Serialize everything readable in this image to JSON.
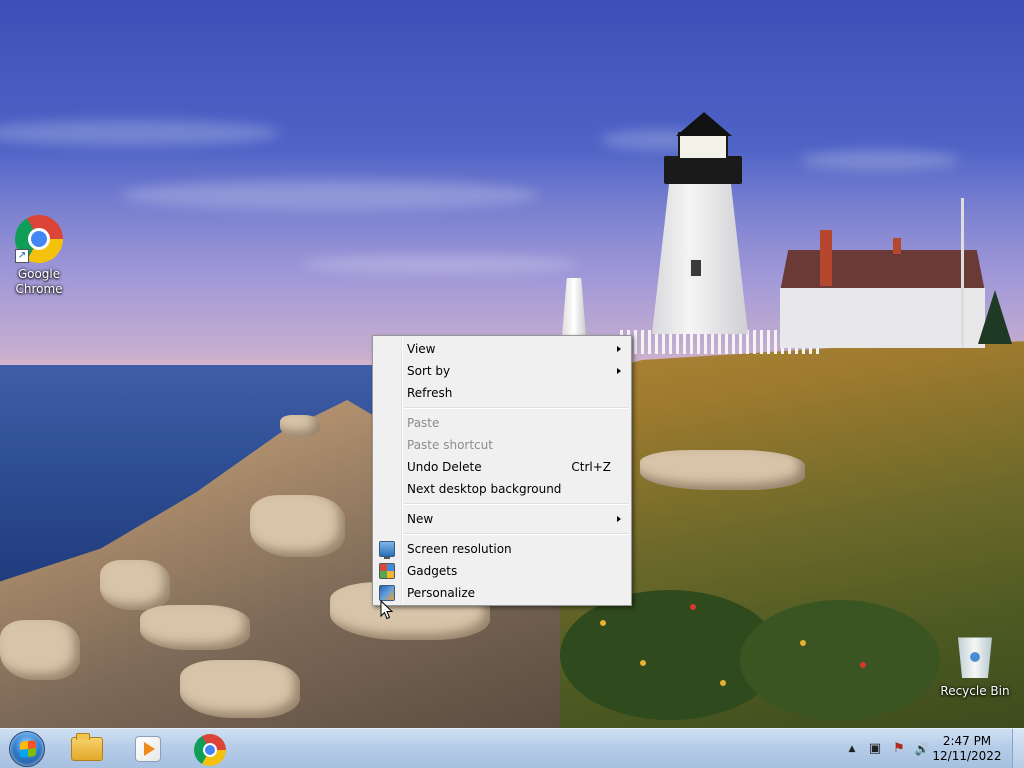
{
  "desktop": {
    "icons": [
      {
        "label": "Google\nChrome",
        "icon": "chrome-icon"
      },
      {
        "label": "Recycle Bin",
        "icon": "recycle-bin-icon"
      }
    ]
  },
  "context_menu": {
    "items": [
      {
        "label": "View",
        "submenu": true
      },
      {
        "label": "Sort by",
        "submenu": true
      },
      {
        "label": "Refresh"
      },
      {
        "separator": true
      },
      {
        "label": "Paste",
        "disabled": true
      },
      {
        "label": "Paste shortcut",
        "disabled": true
      },
      {
        "label": "Undo Delete",
        "shortcut": "Ctrl+Z"
      },
      {
        "label": "Next desktop background"
      },
      {
        "separator": true
      },
      {
        "label": "New",
        "submenu": true
      },
      {
        "separator": true
      },
      {
        "label": "Screen resolution",
        "icon": "screen-resolution-icon"
      },
      {
        "label": "Gadgets",
        "icon": "gadgets-icon"
      },
      {
        "label": "Personalize",
        "icon": "personalize-icon"
      }
    ]
  },
  "taskbar": {
    "start_icon": "windows-start-orb-icon",
    "pinned": [
      {
        "name": "windows-explorer",
        "icon": "folder-icon"
      },
      {
        "name": "windows-media-player",
        "icon": "media-player-icon"
      },
      {
        "name": "google-chrome",
        "icon": "chrome-icon"
      }
    ],
    "tray": {
      "show_hidden_symbol": "▲",
      "network_symbol": "▣",
      "action_center_symbol": "⚑",
      "volume_symbol": "🔊",
      "time": "2:47 PM",
      "date": "12/11/2022"
    }
  },
  "colors": {
    "menu_bg": "#f0f0f0",
    "menu_disabled_text": "#8d8d8d",
    "taskbar_top": "#cfe0f2"
  }
}
